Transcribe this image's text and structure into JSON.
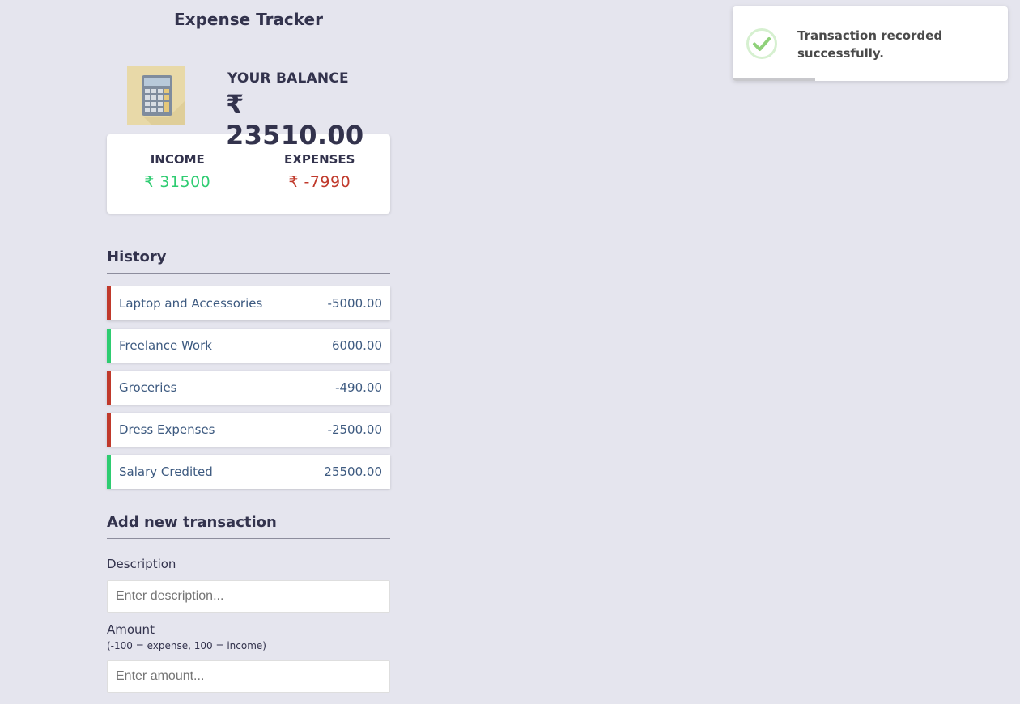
{
  "app": {
    "title": "Expense Tracker"
  },
  "balance": {
    "label": "YOUR BALANCE",
    "value": "₹ 23510.00"
  },
  "summary": {
    "income_label": "INCOME",
    "income_value": "₹ 31500",
    "expenses_label": "EXPENSES",
    "expenses_value": "₹ -7990"
  },
  "history": {
    "title": "History",
    "items": [
      {
        "name": "Laptop and Accessories",
        "amount": "-5000.00",
        "type": "minus"
      },
      {
        "name": "Freelance Work",
        "amount": "6000.00",
        "type": "plus"
      },
      {
        "name": "Groceries",
        "amount": "-490.00",
        "type": "minus"
      },
      {
        "name": "Dress Expenses",
        "amount": "-2500.00",
        "type": "minus"
      },
      {
        "name": "Salary Credited",
        "amount": "25500.00",
        "type": "plus"
      }
    ]
  },
  "form": {
    "title": "Add new transaction",
    "description_label": "Description",
    "description_placeholder": "Enter description...",
    "amount_label": "Amount",
    "amount_hint": "(-100 = expense, 100 = income)",
    "amount_placeholder": "Enter amount..."
  },
  "toast": {
    "message": "Transaction recorded successfully.",
    "progress": 0.3
  },
  "colors": {
    "income": "#2ecc71",
    "expense": "#c0392b",
    "background": "#e5e5ee",
    "text": "#33334d"
  }
}
